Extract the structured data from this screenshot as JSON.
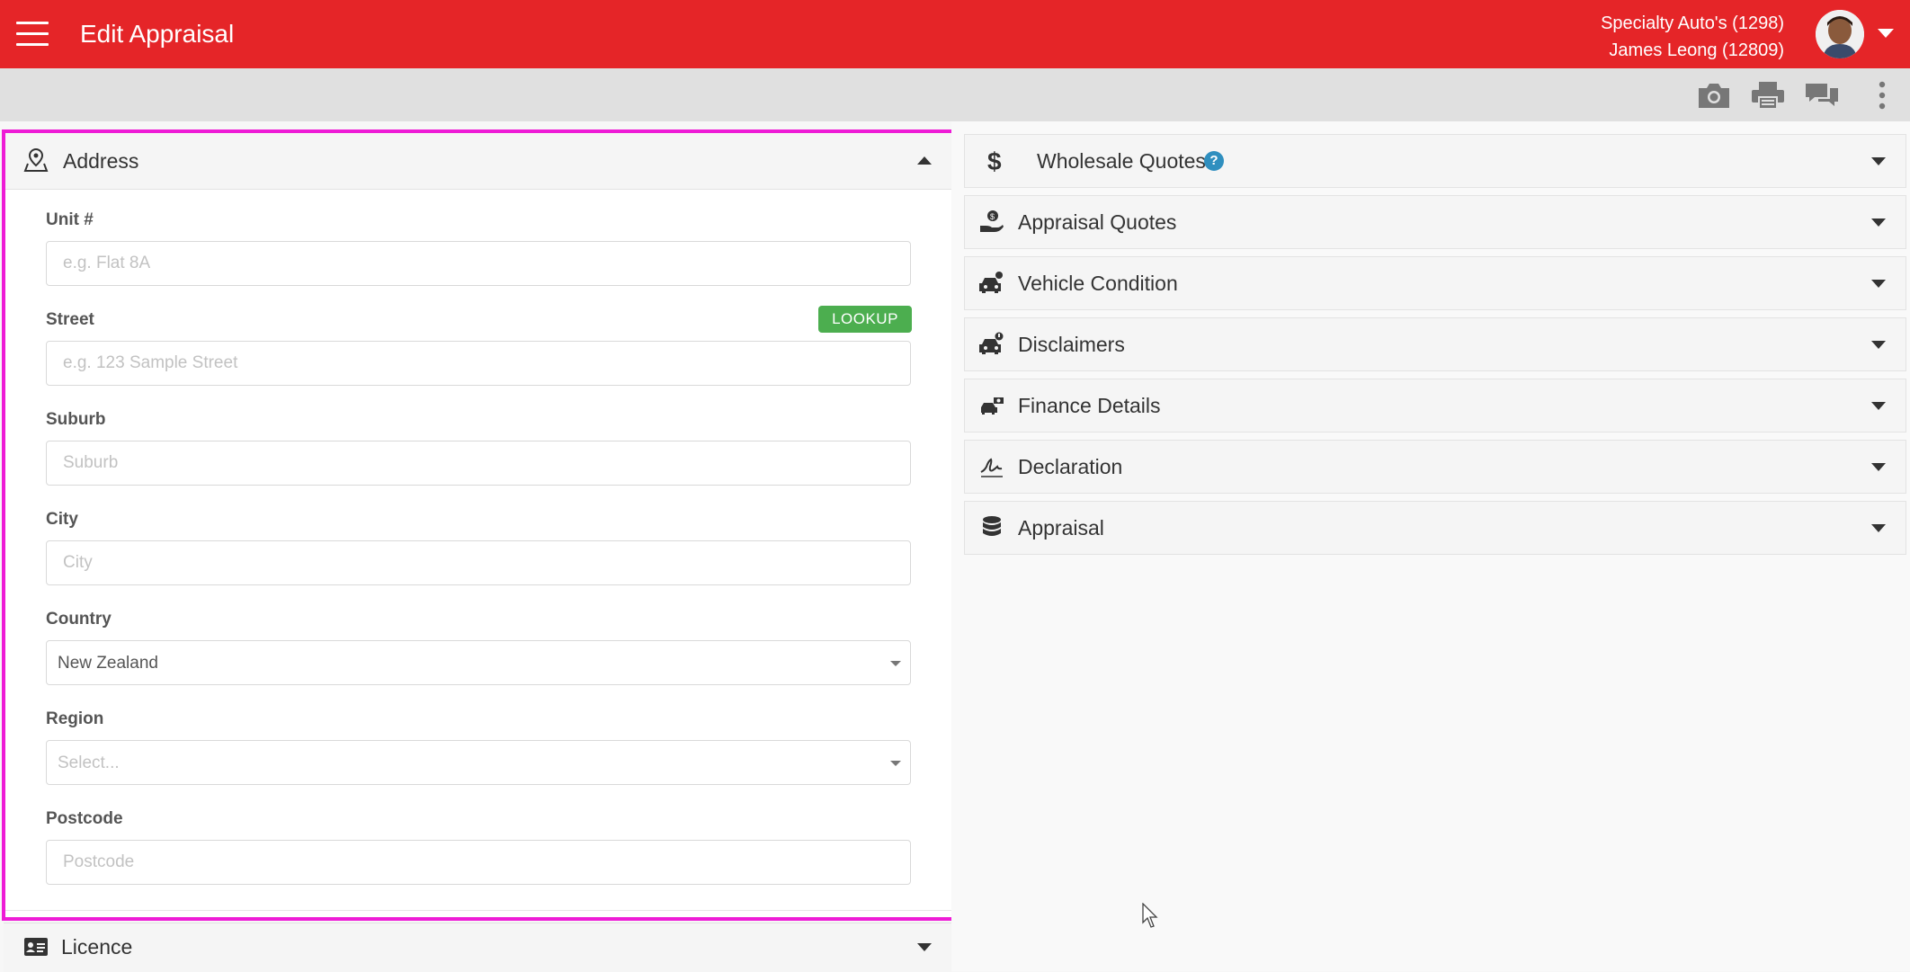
{
  "header": {
    "title": "Edit Appraisal",
    "dealer": "Specialty Auto's (1298)",
    "user": "James Leong (12809)"
  },
  "toolbar": {
    "icons": [
      "camera-icon",
      "print-icon",
      "chat-icon",
      "more-vertical-icon"
    ]
  },
  "address": {
    "title": "Address",
    "fields": {
      "unit": {
        "label": "Unit #",
        "placeholder": "e.g. Flat 8A"
      },
      "street": {
        "label": "Street",
        "placeholder": "e.g. 123 Sample Street",
        "lookup_label": "LOOKUP"
      },
      "suburb": {
        "label": "Suburb",
        "placeholder": "Suburb"
      },
      "city": {
        "label": "City",
        "placeholder": "City"
      },
      "country": {
        "label": "Country",
        "value": "New Zealand"
      },
      "region": {
        "label": "Region",
        "placeholder": "Select..."
      },
      "postcode": {
        "label": "Postcode",
        "placeholder": "Postcode"
      }
    }
  },
  "licence": {
    "title": "Licence"
  },
  "accordion": [
    {
      "label": "Wholesale Quotes",
      "icon": "dollar-icon",
      "help": "?"
    },
    {
      "label": "Appraisal Quotes",
      "icon": "hand-coin-icon"
    },
    {
      "label": "Vehicle Condition",
      "icon": "car-wrench-icon"
    },
    {
      "label": "Disclaimers",
      "icon": "car-alert-icon"
    },
    {
      "label": "Finance Details",
      "icon": "car-money-icon"
    },
    {
      "label": "Declaration",
      "icon": "signature-icon"
    },
    {
      "label": "Appraisal",
      "icon": "database-icon"
    }
  ],
  "colors": {
    "brand_red": "#e52528",
    "focus_magenta": "#ee1cd6",
    "lookup_green": "#4cae4f",
    "help_blue": "#2f8fbf"
  }
}
